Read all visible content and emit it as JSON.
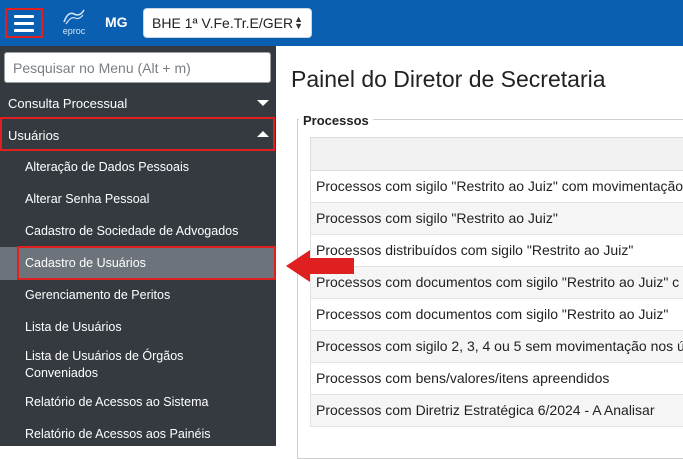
{
  "header": {
    "logo_text": "eproc",
    "locale": "MG",
    "unit_select_value": "BHE 1ª V.Fe.Tr.E/GER"
  },
  "sidebar": {
    "search_placeholder": "Pesquisar no Menu (Alt + m)",
    "sections": [
      {
        "label": "Consulta Processual",
        "expanded": false
      },
      {
        "label": "Usuários",
        "expanded": true
      }
    ],
    "items": [
      {
        "label": "Alteração de Dados Pessoais"
      },
      {
        "label": "Alterar Senha Pessoal"
      },
      {
        "label": "Cadastro de Sociedade de Advogados"
      },
      {
        "label": "Cadastro de Usuários",
        "active": true
      },
      {
        "label": "Gerenciamento de Peritos"
      },
      {
        "label": "Lista de Usuários"
      },
      {
        "label": "Lista de Usuários de Órgãos Conveniados"
      },
      {
        "label": "Relatório de Acessos ao Sistema"
      },
      {
        "label": "Relatório de Acessos aos Painéis"
      }
    ]
  },
  "main": {
    "title": "Painel do Diretor de Secretaria",
    "fieldset_legend": "Processos",
    "rows": [
      "Processos com sigilo \"Restrito ao Juiz\" com movimentação",
      "Processos com sigilo \"Restrito ao Juiz\"",
      "Processos distribuídos com sigilo \"Restrito ao Juiz\"",
      "Processos com documentos com sigilo \"Restrito ao Juiz\" c",
      "Processos com documentos com sigilo \"Restrito ao Juiz\"",
      "Processos com sigilo 2, 3, 4 ou 5 sem movimentação nos ú",
      "Processos com bens/valores/itens apreendidos",
      "Processos com Diretriz Estratégica 6/2024 - A Analisar"
    ]
  },
  "colors": {
    "topbar": "#0b5fb0",
    "sidebar": "#343a40",
    "highlight": "#e02020",
    "active_item": "#6c737a"
  }
}
